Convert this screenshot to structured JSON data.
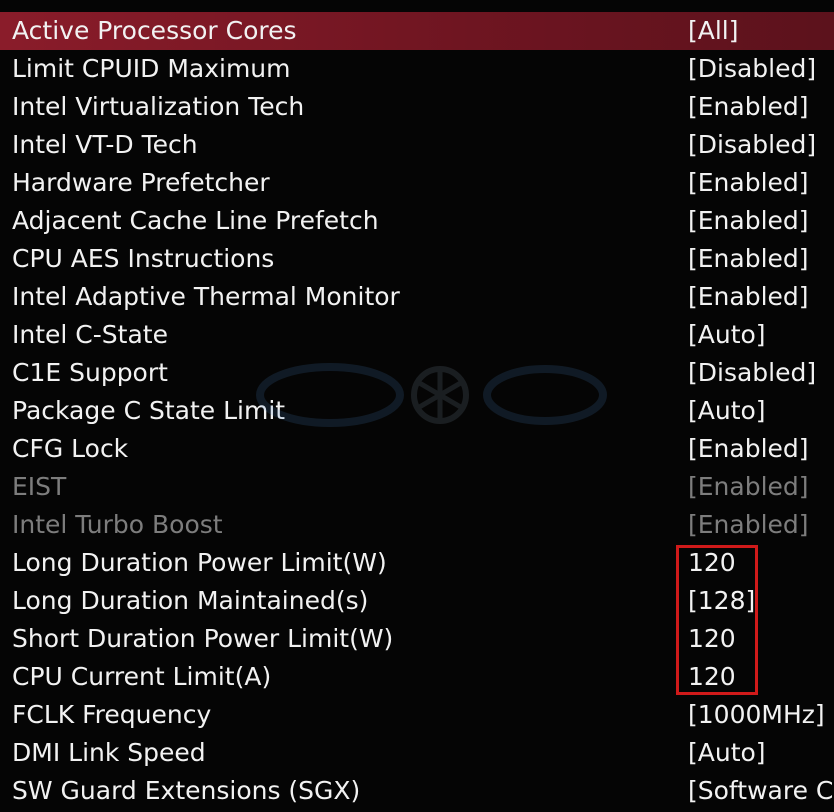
{
  "settings": [
    {
      "label": "Active Processor Cores",
      "value": "[All]",
      "selected": true
    },
    {
      "label": "Limit CPUID Maximum",
      "value": "[Disabled]"
    },
    {
      "label": "Intel Virtualization Tech",
      "value": "[Enabled]"
    },
    {
      "label": "Intel VT-D Tech",
      "value": "[Disabled]"
    },
    {
      "label": "Hardware Prefetcher",
      "value": "[Enabled]"
    },
    {
      "label": "Adjacent Cache Line Prefetch",
      "value": "[Enabled]"
    },
    {
      "label": "CPU AES Instructions",
      "value": "[Enabled]"
    },
    {
      "label": "Intel Adaptive Thermal Monitor",
      "value": "[Enabled]"
    },
    {
      "label": "Intel C-State",
      "value": "[Auto]"
    },
    {
      "label": "C1E Support",
      "value": "[Disabled]"
    },
    {
      "label": "Package C State Limit",
      "value": "[Auto]"
    },
    {
      "label": "CFG Lock",
      "value": "[Enabled]"
    },
    {
      "label": "EIST",
      "value": "[Enabled]",
      "disabled": true
    },
    {
      "label": "Intel Turbo Boost",
      "value": "[Enabled]",
      "disabled": true
    },
    {
      "label": "Long Duration Power Limit(W)",
      "value": "120"
    },
    {
      "label": "Long Duration Maintained(s)",
      "value": "[128]"
    },
    {
      "label": "Short Duration Power Limit(W)",
      "value": "120"
    },
    {
      "label": "CPU Current Limit(A)",
      "value": "120"
    },
    {
      "label": "FCLK Frequency",
      "value": "[1000MHz]"
    },
    {
      "label": "DMI Link Speed",
      "value": "[Auto]"
    },
    {
      "label": "SW Guard Extensions (SGX)",
      "value": "[Software Co"
    }
  ],
  "colors": {
    "selected_row": "#8a1c2a",
    "highlight_border": "#d01a1a",
    "text": "#f2f2f2",
    "disabled_text": "#7d7d7d"
  }
}
